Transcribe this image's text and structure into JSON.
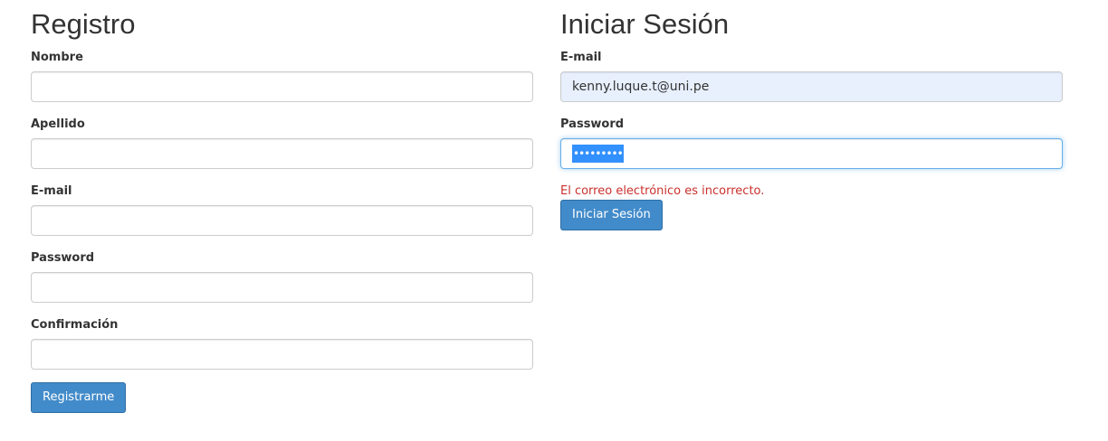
{
  "register": {
    "title": "Registro",
    "fields": [
      {
        "label": "Nombre",
        "value": ""
      },
      {
        "label": "Apellido",
        "value": ""
      },
      {
        "label": "E-mail",
        "value": ""
      },
      {
        "label": "Password",
        "value": ""
      },
      {
        "label": "Confirmación",
        "value": ""
      }
    ],
    "submit_label": "Registrarme",
    "button_color": "#428bca"
  },
  "login": {
    "title": "Iniciar Sesión",
    "email": {
      "label": "E-mail",
      "value": "kenny.luque.t@uni.pe"
    },
    "password": {
      "label": "Password",
      "masked_value": "•••••••••"
    },
    "error_message": "El correo electrónico es incorrecto.",
    "submit_label": "Iniciar Sesión",
    "error_color": "#c9302c",
    "autofill_color": "#e8f0fe"
  }
}
